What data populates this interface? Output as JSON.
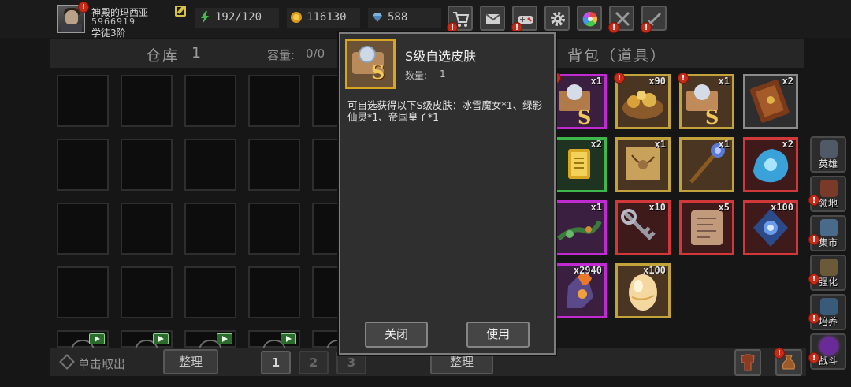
{
  "player": {
    "name": "神殿的玛西亚",
    "id": "5966919",
    "rank": "学徒3阶",
    "alert": "!"
  },
  "resources": [
    {
      "name": "energy",
      "icon": "lightning-icon",
      "value": "192/120"
    },
    {
      "name": "gold",
      "icon": "coin-icon",
      "value": "116130"
    },
    {
      "name": "gems",
      "icon": "gem-icon",
      "value": "588"
    }
  ],
  "toolbar": [
    {
      "icon": "shop-cart-icon",
      "alert": true
    },
    {
      "icon": "mail-icon",
      "alert": false
    },
    {
      "icon": "gamepad-icon",
      "alert": true
    },
    {
      "icon": "settings-gear-icon",
      "alert": false
    },
    {
      "icon": "color-wheel-icon",
      "alert": false
    },
    {
      "icon": "swords-icon",
      "alert": true
    },
    {
      "icon": "battle-sword-icon",
      "alert": true
    }
  ],
  "warehouse": {
    "title": "仓库",
    "page_num": "1",
    "capacity_label": "容量:",
    "capacity_value": "0/0",
    "ad_badge": "AD"
  },
  "bag": {
    "title": "背包（道具）",
    "items": [
      {
        "name": "s-skin-chest",
        "qty": "x1",
        "rarity": "purple",
        "alert": true
      },
      {
        "name": "treasure-pile",
        "qty": "x90",
        "rarity": "gold",
        "alert": true
      },
      {
        "name": "s-skin-chest-gold",
        "qty": "x1",
        "rarity": "gold",
        "alert": true
      },
      {
        "name": "spell-book",
        "qty": "x2",
        "rarity": "gray",
        "alert": false
      },
      {
        "name": "gold-card",
        "qty": "x2",
        "rarity": "green",
        "alert": false
      },
      {
        "name": "treasure-map",
        "qty": "x1",
        "rarity": "gold",
        "alert": false
      },
      {
        "name": "magic-staff",
        "qty": "x1",
        "rarity": "gold",
        "alert": false
      },
      {
        "name": "ice-crystal",
        "qty": "x2",
        "rarity": "red",
        "alert": false
      },
      {
        "name": "vine-branch",
        "qty": "x1",
        "rarity": "purple",
        "alert": false
      },
      {
        "name": "iron-key",
        "qty": "x10",
        "rarity": "red",
        "alert": false
      },
      {
        "name": "scroll-map",
        "qty": "x5",
        "rarity": "red",
        "alert": false
      },
      {
        "name": "rune-stone",
        "qty": "x100",
        "rarity": "red",
        "alert": false
      },
      {
        "name": "fire-gauntlet",
        "qty": "x2940",
        "rarity": "purple",
        "alert": false
      },
      {
        "name": "golden-egg",
        "qty": "x100",
        "rarity": "gold",
        "alert": false
      }
    ]
  },
  "sidebar": [
    {
      "label": "英雄",
      "icon": "hero-helmet-icon",
      "alert": false
    },
    {
      "label": "领地",
      "icon": "territory-castle-icon",
      "alert": true
    },
    {
      "label": "集市",
      "icon": "market-stall-icon",
      "alert": true
    },
    {
      "label": "强化",
      "icon": "enhance-anvil-icon",
      "alert": true
    },
    {
      "label": "培养",
      "icon": "training-statue-icon",
      "alert": true
    },
    {
      "label": "战斗",
      "icon": "battle-portal-icon",
      "alert": true
    }
  ],
  "bottom": {
    "take_out": "单击取出",
    "sort_left": "整理",
    "pages": [
      "1",
      "2",
      "3"
    ],
    "sort_right": "整理"
  },
  "popup": {
    "title": "S级自选皮肤",
    "qty_label": "数量:",
    "qty_value": "1",
    "description": "可自选获得以下S级皮肤：冰雪魔女*1、绿影仙灵*1、帝国皇子*1",
    "close_label": "关闭",
    "use_label": "使用"
  },
  "colors": {
    "rarity_purple": "#c02ad0",
    "rarity_gold": "#c2a23b",
    "rarity_green": "#3fb84b",
    "rarity_red": "#d0383a",
    "alert_red": "#c62a18"
  }
}
